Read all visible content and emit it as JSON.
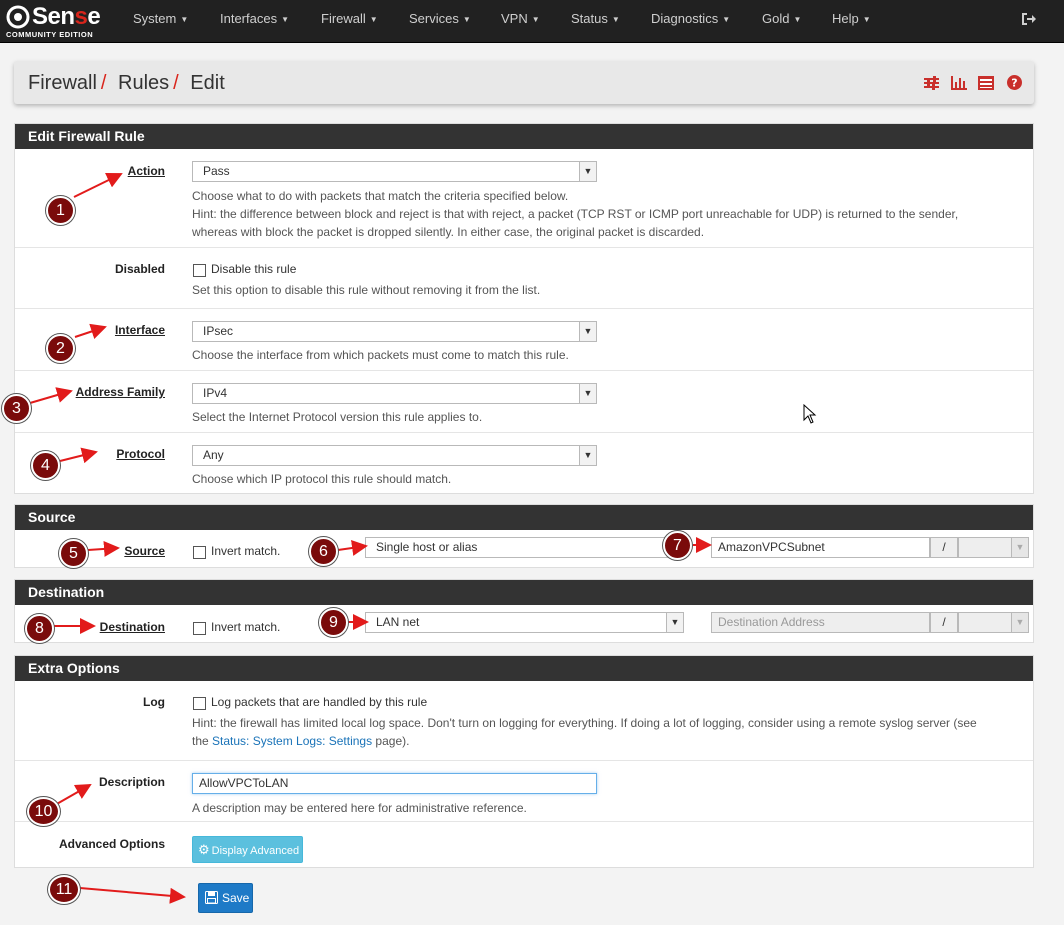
{
  "nav": {
    "brand_prefix": "Sen",
    "brand_red": "s",
    "brand_suffix": "e",
    "edition": "COMMUNITY EDITION",
    "items": [
      "System",
      "Interfaces",
      "Firewall",
      "Services",
      "VPN",
      "Status",
      "Diagnostics",
      "Gold",
      "Help"
    ]
  },
  "breadcrumb": {
    "items": [
      "Firewall",
      "Rules",
      "Edit"
    ]
  },
  "edit_rule": {
    "heading": "Edit Firewall Rule",
    "action": {
      "label": "Action",
      "value": "Pass",
      "help1": "Choose what to do with packets that match the criteria specified below.",
      "help2": "Hint: the difference between block and reject is that with reject, a packet (TCP RST or ICMP port unreachable for UDP) is returned to the sender,",
      "help3": "whereas with block the packet is dropped silently. In either case, the original packet is discarded."
    },
    "disabled": {
      "label": "Disabled",
      "checkbox_label": "Disable this rule",
      "help": "Set this option to disable this rule without removing it from the list."
    },
    "interface": {
      "label": "Interface",
      "value": "IPsec",
      "help": "Choose the interface from which packets must come to match this rule."
    },
    "address_family": {
      "label": "Address Family",
      "value": "IPv4",
      "help": "Select the Internet Protocol version this rule applies to."
    },
    "protocol": {
      "label": "Protocol",
      "value": "Any",
      "help": "Choose which IP protocol this rule should match."
    }
  },
  "source": {
    "heading": "Source",
    "label": "Source",
    "invert_label": "Invert match.",
    "type": "Single host or alias",
    "address": "AmazonVPCSubnet",
    "slash": "/"
  },
  "destination": {
    "heading": "Destination",
    "label": "Destination",
    "invert_label": "Invert match.",
    "type": "LAN net",
    "address_placeholder": "Destination Address",
    "slash": "/"
  },
  "extra": {
    "heading": "Extra Options",
    "log": {
      "label": "Log",
      "checkbox_label": "Log packets that are handled by this rule",
      "help1": "Hint: the firewall has limited local log space. Don't turn on logging for everything. If doing a lot of logging, consider using a remote syslog server (see",
      "help2_pre": "the ",
      "help2_link": "Status: System Logs: Settings",
      "help2_post": " page)."
    },
    "description": {
      "label": "Description",
      "value": "AllowVPCToLAN",
      "help": "A description may be entered here for administrative reference."
    },
    "advanced": {
      "label": "Advanced Options",
      "button": "Display Advanced"
    }
  },
  "save_button": "Save",
  "annotations": [
    "1",
    "2",
    "3",
    "4",
    "5",
    "6",
    "7",
    "8",
    "9",
    "10",
    "11"
  ],
  "colors": {
    "navbar": "#212121",
    "accent_red": "#d9251c",
    "panel_heading": "#333333",
    "badge": "#7a0b0b",
    "save_blue": "#1e7ac7",
    "info_blue": "#5bc0de"
  }
}
